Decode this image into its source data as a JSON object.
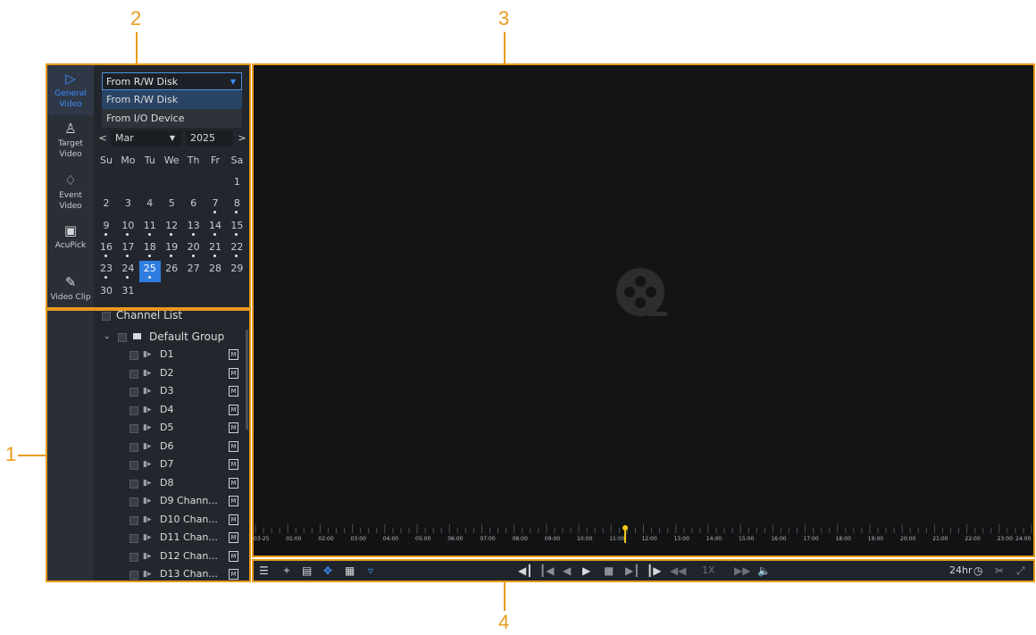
{
  "callouts": [
    "1",
    "2",
    "3",
    "4"
  ],
  "sidebar": {
    "items": [
      {
        "label": "General Video",
        "icon": "play-square-icon",
        "active": true
      },
      {
        "label": "Target Video",
        "icon": "person-target-icon",
        "active": false
      },
      {
        "label": "Event Video",
        "icon": "bell-icon",
        "active": false
      },
      {
        "label": "AcuPick",
        "icon": "scan-person-icon",
        "active": false
      },
      {
        "label": "Video Clip",
        "icon": "edit-clip-icon",
        "active": false
      }
    ]
  },
  "source": {
    "selected": "From R/W Disk",
    "options": [
      "From R/W Disk",
      "From I/O Device"
    ]
  },
  "calendar": {
    "month": "Mar",
    "year": "2025",
    "prev": "<",
    "next": ">",
    "weekdays": [
      "Su",
      "Mo",
      "Tu",
      "We",
      "Th",
      "Fr",
      "Sa"
    ],
    "selected_day": 25,
    "days_with_recordings": [
      7,
      8,
      9,
      10,
      11,
      12,
      13,
      14,
      15,
      16,
      17,
      18,
      19,
      20,
      21,
      22,
      23,
      24,
      25
    ]
  },
  "channels": {
    "header": "Channel List",
    "group": "Default Group",
    "badge": "M",
    "items": [
      "D1",
      "D2",
      "D3",
      "D4",
      "D5",
      "D6",
      "D7",
      "D8",
      "D9 Chann...",
      "D10 Chan...",
      "D11 Chan...",
      "D12 Chan...",
      "D13 Chan..."
    ]
  },
  "timeline": {
    "labels": [
      "03-25",
      "01:00",
      "02:00",
      "03:00",
      "04:00",
      "05:00",
      "06:00",
      "07:00",
      "08:00",
      "09:00",
      "10:00",
      "11:00",
      "12:00",
      "13:00",
      "14:00",
      "15:00",
      "16:00",
      "17:00",
      "18:00",
      "19:00",
      "20:00",
      "21:00",
      "22:00",
      "23:00",
      "24:00"
    ]
  },
  "controls": {
    "speed": "1X",
    "mode": "24hr"
  },
  "colors": {
    "accent": "#e89a1c",
    "selected_blue": "#2f7de1",
    "marker_yellow": "#f5c518"
  }
}
